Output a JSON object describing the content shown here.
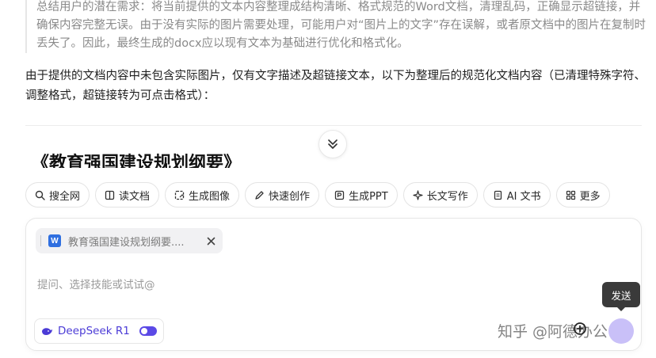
{
  "reasoning": {
    "text": "总结用户的潜在需求：将当前提供的文本内容整理成结构清晰、格式规范的Word文档，清理乱码，正确显示超链接，并确保内容完整无误。由于没有实际的图片需要处理，可能用户对“图片上的文字”存在误解，或者原文档中的图片在复制时丢失了。因此，最终生成的docx应以现有文本为基础进行优化和格式化。"
  },
  "answer": {
    "text": "由于提供的文档内容中未包含实际图片，仅有文字描述及超链接文本，以下为整理后的规范化文档内容（已清理特殊字符、调整格式，超链接转为可点击格式）："
  },
  "document": {
    "heading": "《教育强国建设规划纲要》"
  },
  "skills": [
    {
      "label": "搜全网",
      "icon": "search-icon"
    },
    {
      "label": "读文档",
      "icon": "book-icon"
    },
    {
      "label": "生成图像",
      "icon": "image-icon"
    },
    {
      "label": "快速创作",
      "icon": "pen-icon"
    },
    {
      "label": "生成PPT",
      "icon": "ppt-icon"
    },
    {
      "label": "长文写作",
      "icon": "sparkle-icon"
    },
    {
      "label": "AI 文书",
      "icon": "document-icon"
    },
    {
      "label": "更多",
      "icon": "grid-icon"
    }
  ],
  "composer": {
    "attachment": {
      "name": "教育强国建设规划纲要....",
      "icon_letter": "W"
    },
    "placeholder": "提问、选择技能或试试@",
    "model": {
      "label": "DeepSeek R1",
      "enabled": true
    },
    "send_tooltip": "发送"
  },
  "watermark": "知乎 @阿德办公",
  "colors": {
    "accent": "#5b49e6",
    "send_button": "#c9c0f8",
    "word_icon": "#2f6fe0",
    "muted_text": "#8a8a8a"
  }
}
